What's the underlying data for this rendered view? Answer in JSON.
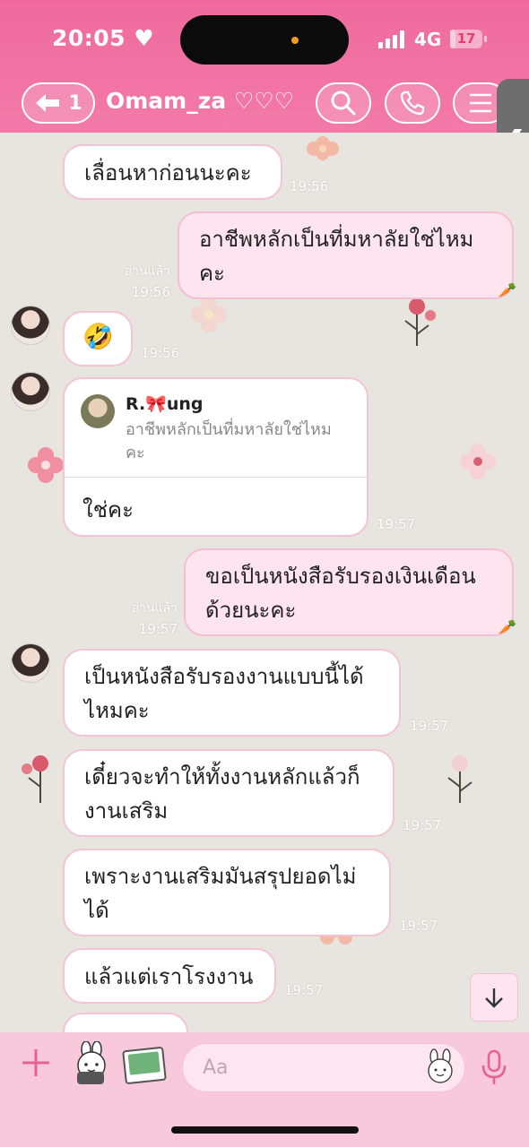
{
  "status_bar": {
    "time": "20:05",
    "network": "4G",
    "battery": "17",
    "battery_level": 0.17
  },
  "header": {
    "back_count": "1",
    "title": "Omam_za ♡♡♡",
    "icons": [
      "back-arrow-icon",
      "search-icon",
      "phone-icon",
      "menu-icon"
    ],
    "side_tab_glyph": "❮"
  },
  "messages": [
    {
      "side": "in",
      "text": "เลื่อนหาก่อนนะคะ",
      "time": "19:56"
    },
    {
      "side": "out",
      "lines": [
        "อาชีพหลักเป็นที่มหาลัยใช่ไหม",
        "คะ"
      ],
      "read": "อ่านแล้ว",
      "time": "19:56"
    },
    {
      "side": "in",
      "emoji": "🤣",
      "time": "19:56"
    },
    {
      "side": "in",
      "reply_to": {
        "name": "R.🎀ung",
        "lines": [
          "อาชีพหลักเป็นที่มหาลัยใช่ไหม",
          "คะ"
        ]
      },
      "text": "ใช่คะ",
      "time": "19:57"
    },
    {
      "side": "out",
      "lines": [
        "ขอเป็นหนังสือรับรองเงินเดือน",
        "ด้วยนะคะ"
      ],
      "read": "อ่านแล้ว",
      "time": "19:57"
    },
    {
      "side": "in",
      "lines": [
        "เป็นหนังสือรับรองงานแบบนี้ได้",
        "ไหมคะ"
      ],
      "time": "19:57"
    },
    {
      "side": "in",
      "lines": [
        "เดี๋ยวจะทำให้ทั้งงานหลักแล้วก็",
        "งานเสริม"
      ],
      "time": "19:57"
    },
    {
      "side": "in",
      "lines": [
        "เพราะงานเสริมมันสรุปยอดไม่",
        "ได้"
      ],
      "time": "19:57"
    },
    {
      "side": "in",
      "text": "แล้วแต่เราโรงงาน",
      "time": "19:57"
    }
  ],
  "composer": {
    "placeholder": "Aa",
    "icons": [
      "plus-icon",
      "sticker-icon",
      "photo-icon",
      "emoji-icon",
      "mic-icon"
    ]
  },
  "colors": {
    "header_pink": "#f06a9e",
    "bubble_out": "#fde4ee",
    "bubble_border": "#f4c4d5",
    "chat_bg": "#e8e4df",
    "composer_bg": "#f7c9da"
  }
}
